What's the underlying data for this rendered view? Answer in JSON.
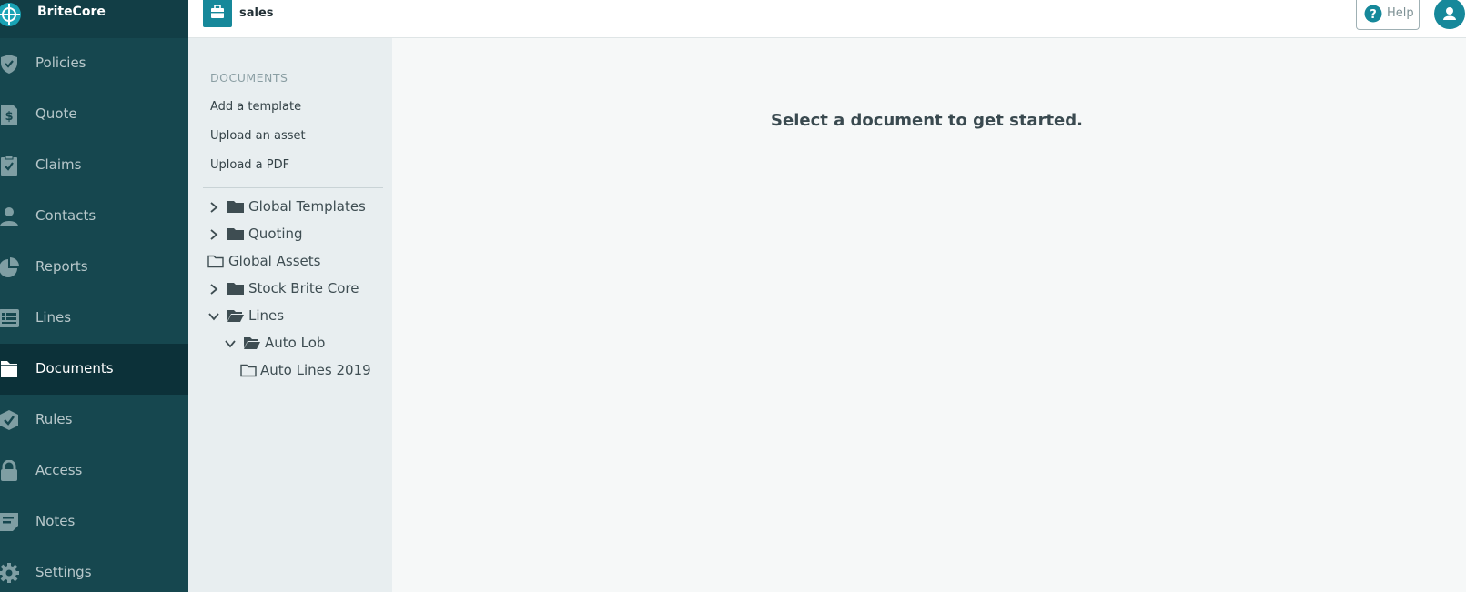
{
  "brand": {
    "name": "BriteCore",
    "logo_icon": "britecore-logo-icon"
  },
  "nav": {
    "items": [
      {
        "label": "Policies",
        "icon": "shield-check-icon",
        "active": false
      },
      {
        "label": "Quote",
        "icon": "dollar-document-icon",
        "active": false
      },
      {
        "label": "Claims",
        "icon": "clipboard-check-icon",
        "active": false
      },
      {
        "label": "Contacts",
        "icon": "person-icon",
        "active": false
      },
      {
        "label": "Reports",
        "icon": "pie-chart-icon",
        "active": false
      },
      {
        "label": "Lines",
        "icon": "list-icon",
        "active": false
      },
      {
        "label": "Documents",
        "icon": "file-icon",
        "active": true
      },
      {
        "label": "Rules",
        "icon": "rules-icon",
        "active": false
      },
      {
        "label": "Access",
        "icon": "lock-icon",
        "active": false
      },
      {
        "label": "Notes",
        "icon": "note-icon",
        "active": false
      },
      {
        "label": "Settings",
        "icon": "gear-icon",
        "active": false
      }
    ]
  },
  "topbar": {
    "team_name": "sales",
    "team_icon": "briefcase-icon",
    "help_label": "Help",
    "user_icon": "user-avatar-icon"
  },
  "documents": {
    "heading": "DOCUMENTS",
    "actions": [
      "Add a template",
      "Upload an asset",
      "Upload a PDF"
    ],
    "tree": [
      {
        "label": "Global Templates",
        "state": "collapsed",
        "depth": 0
      },
      {
        "label": "Quoting",
        "state": "collapsed",
        "depth": 0
      },
      {
        "label": "Global Assets",
        "state": "leaf",
        "depth": 0
      },
      {
        "label": "Stock Brite Core",
        "state": "collapsed",
        "depth": 0
      },
      {
        "label": "Lines",
        "state": "expanded",
        "depth": 0
      },
      {
        "label": "Auto Lob",
        "state": "expanded",
        "depth": 1
      },
      {
        "label": "Auto Lines 2019",
        "state": "leaf",
        "depth": 2
      }
    ]
  },
  "main": {
    "empty_message": "Select a document to get started."
  },
  "colors": {
    "nav_bg": "#16474f",
    "nav_active": "#0c3139",
    "accent": "#16889a",
    "panel_bg": "#e8eef0",
    "main_bg": "#f6f8f8"
  }
}
